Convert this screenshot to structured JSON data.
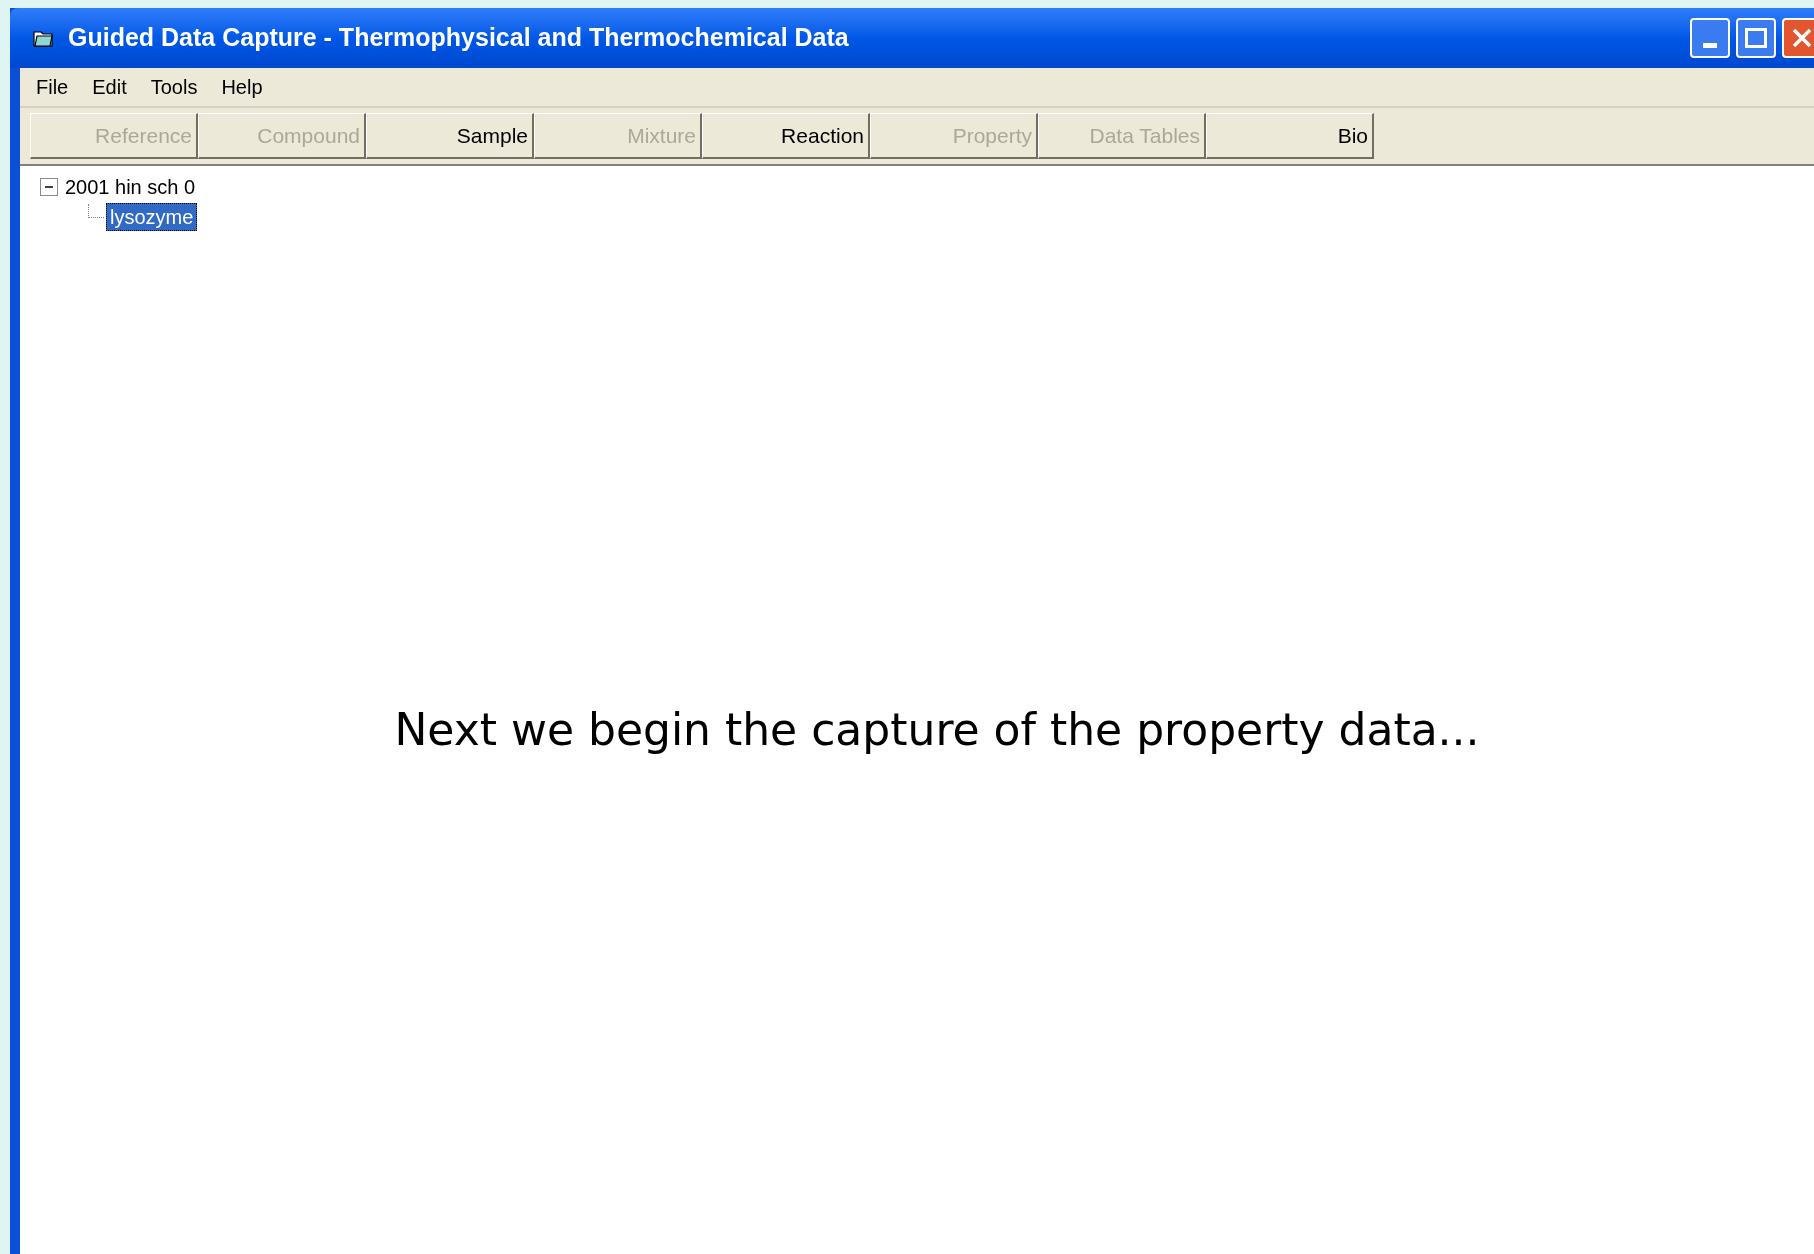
{
  "window": {
    "title": "Guided Data Capture - Thermophysical and Thermochemical Data"
  },
  "menu": [
    "File",
    "Edit",
    "Tools",
    "Help"
  ],
  "toolbar": [
    {
      "label": "Reference",
      "disabled": true
    },
    {
      "label": "Compound",
      "disabled": true
    },
    {
      "label": "Sample",
      "disabled": false
    },
    {
      "label": "Mixture",
      "disabled": true
    },
    {
      "label": "Reaction",
      "disabled": false
    },
    {
      "label": "Property",
      "disabled": true
    },
    {
      "label": "Data Tables",
      "disabled": true
    },
    {
      "label": "Bio",
      "disabled": false
    }
  ],
  "tree": [
    {
      "label": "2001 hin sch 0",
      "expanded": true,
      "selected": false,
      "children": [
        {
          "label": "lysozyme",
          "selected": true
        }
      ]
    }
  ],
  "caption": "Next we begin the capture of the property data..."
}
